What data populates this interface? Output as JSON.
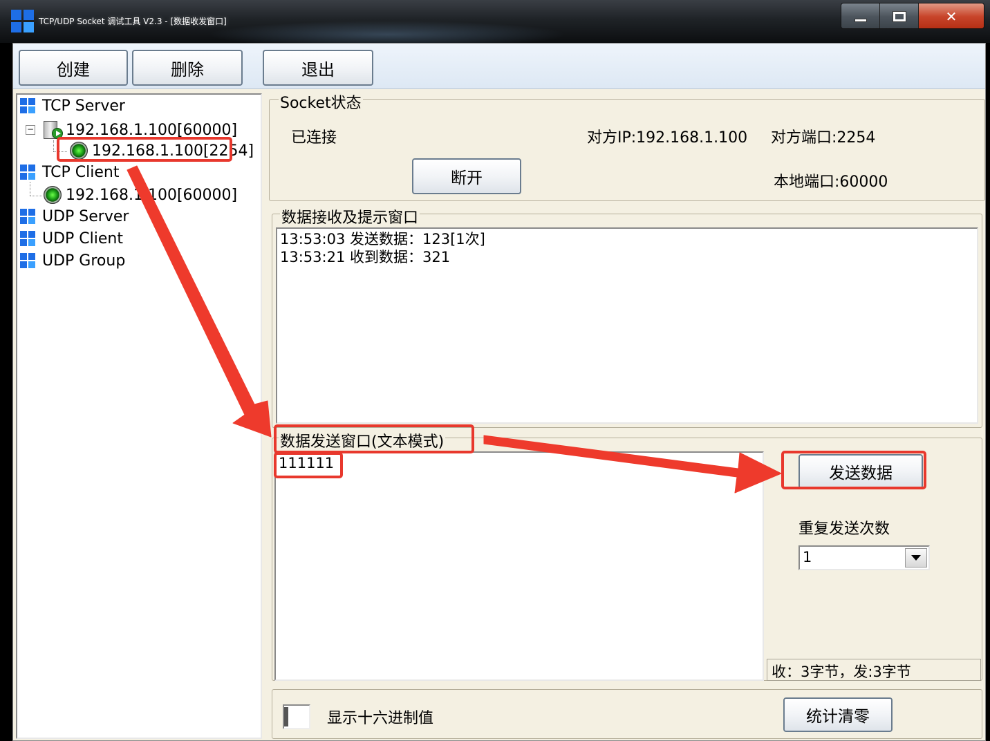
{
  "window": {
    "title": "TCP/UDP Socket 调试工具 V2.3 - [数据收发窗口]",
    "controls": {
      "minimize": "—",
      "close": "✕"
    }
  },
  "toolbar": {
    "create_label": "创建",
    "delete_label": "删除",
    "exit_label": "退出"
  },
  "tree": {
    "tcp_server": "TCP Server",
    "tcp_server_listener": "192.168.1.100[60000]",
    "tcp_server_connection": "192.168.1.100[2254]",
    "tcp_client": "TCP Client",
    "tcp_client_connection": "192.168.1.100[60000]",
    "udp_server": "UDP Server",
    "udp_client": "UDP Client",
    "udp_group": "UDP Group",
    "expander_symbol": "−"
  },
  "socket_status": {
    "group_title": "Socket状态",
    "state": "已连接",
    "remote_ip": "对方IP:192.168.1.100",
    "remote_port": "对方端口:2254",
    "local_port": "本地端口:60000",
    "disconnect_label": "断开"
  },
  "receive": {
    "group_title": "数据接收及提示窗口",
    "log": [
      "13:53:03 发送数据：123[1次]",
      "13:53:21 收到数据：321"
    ]
  },
  "send": {
    "group_title": "数据发送窗口(文本模式)",
    "text": "111111",
    "send_label": "发送数据",
    "repeat_label": "重复发送次数",
    "repeat_value": "1",
    "stats": "收：3字节，发:3字节"
  },
  "bottom": {
    "hex_label": "显示十六进制值",
    "clear_stats_label": "统计清零"
  },
  "colors": {
    "annotation": "#e8382d",
    "panel_bg": "#f4f0e2",
    "icon_blue": "#1e6ee6"
  }
}
